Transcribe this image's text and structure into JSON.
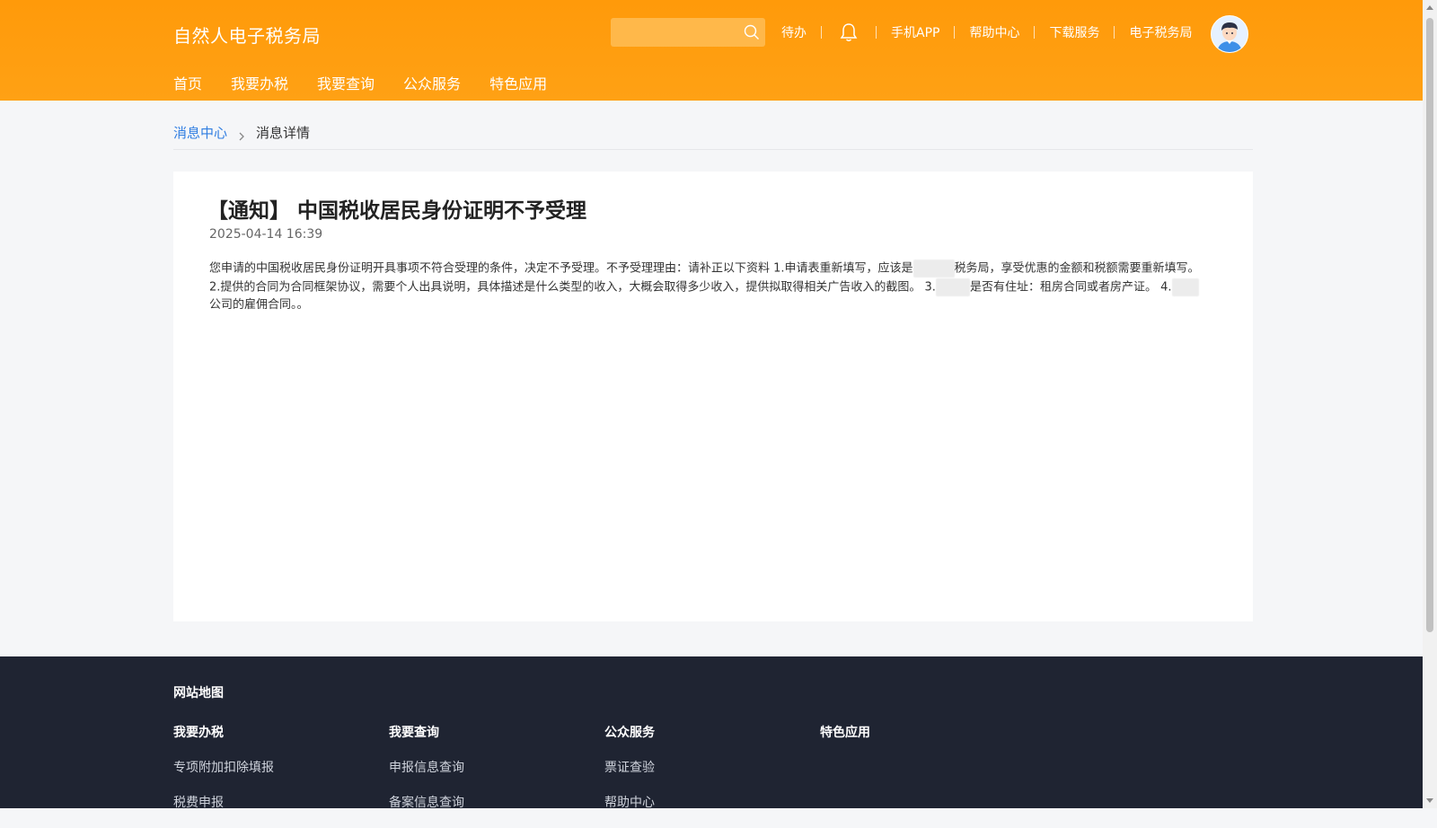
{
  "header": {
    "logo": "自然人电子税务局",
    "search": {
      "placeholder": ""
    },
    "links": {
      "todo": "待办",
      "app": "手机APP",
      "help": "帮助中心",
      "download": "下载服务",
      "etax": "电子税务局"
    },
    "bell_icon": "bell-icon",
    "nav": [
      "首页",
      "我要办税",
      "我要查询",
      "公众服务",
      "特色应用"
    ]
  },
  "breadcrumb": {
    "parent": "消息中心",
    "current": "消息详情"
  },
  "message": {
    "title": "【通知】 中国税收居民身份证明不予受理",
    "date": "2025-04-14 16:39",
    "part1": "您申请的中国税收居民身份证明开具事项不符合受理的条件，决定不予受理。不予受理理由：请补正以下资料 1.申请表重新填写，应该是",
    "part2": "税务局，享受优惠的金额和税额需要重新填写。 2.提供的合同为合同框架协议，需要个人出具说明，具体描述是什么类型的收入，大概会取得多少收入，提供拟取得相关广告收入的截图。 3.",
    "part3": "是否有住址：租房合同或者房产证。 4.",
    "part4": "公司的雇佣合同。。"
  },
  "footer": {
    "map_title": "网站地图",
    "columns": [
      {
        "title": "我要办税",
        "links": [
          "专项附加扣除填报",
          "税费申报"
        ]
      },
      {
        "title": "我要查询",
        "links": [
          "申报信息查询",
          "备案信息查询"
        ]
      },
      {
        "title": "公众服务",
        "links": [
          "票证查验",
          "帮助中心"
        ]
      },
      {
        "title": "特色应用",
        "links": []
      }
    ]
  },
  "colors": {
    "header": "#ff9a0a",
    "link": "#2f7de1",
    "footer": "#1f2432"
  }
}
